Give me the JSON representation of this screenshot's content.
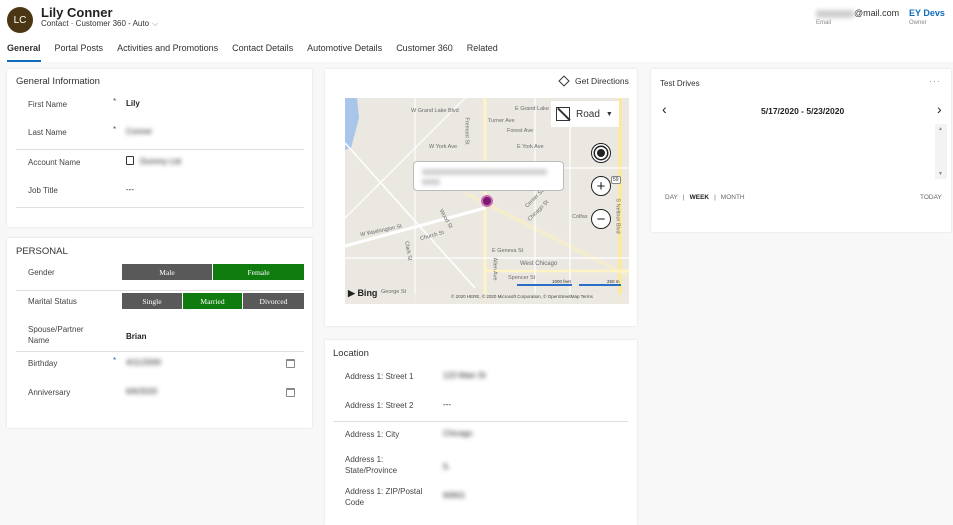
{
  "header": {
    "avatar_initials": "LC",
    "record_name": "Lily Conner",
    "record_subtitle": "Contact · Customer 360 - Auto",
    "email_suffix": "@mail.com",
    "email_label": "Email",
    "owner_value": "EY Devs",
    "owner_label": "Owner",
    "owner_color": "#0f6cbd"
  },
  "tabs": [
    {
      "label": "General",
      "active": true
    },
    {
      "label": "Portal Posts"
    },
    {
      "label": "Activities and Promotions"
    },
    {
      "label": "Contact Details"
    },
    {
      "label": "Automotive Details"
    },
    {
      "label": "Customer 360"
    },
    {
      "label": "Related"
    }
  ],
  "general_info": {
    "title": "General Information",
    "fields": [
      {
        "label": "First Name",
        "required": "*",
        "value": "Lily"
      },
      {
        "label": "Last Name",
        "required": "*",
        "value": "Conner",
        "blurred": true
      },
      {
        "label": "Account Name",
        "value": "Dummy Ltd",
        "blurred": true,
        "icon": "account-icon"
      },
      {
        "label": "Job Title",
        "value": "---"
      }
    ]
  },
  "personal": {
    "title": "PERSONAL",
    "gender": {
      "label": "Gender",
      "options": [
        "Male",
        "Female"
      ],
      "selected": "Female"
    },
    "marital_status": {
      "label": "Marital Status",
      "options": [
        "Single",
        "Married",
        "Divorced"
      ],
      "selected": "Married"
    },
    "spouse": {
      "label": "Spouse/Partner Name",
      "value": "Brian"
    },
    "birthday": {
      "label": "Birthday",
      "required": "*",
      "value": "4/11/2000",
      "blurred": true
    },
    "anniversary": {
      "label": "Anniversary",
      "value": "6/6/2020",
      "blurred": true
    },
    "selected_color": "#107c10",
    "unselected_color": "#595959"
  },
  "map": {
    "get_directions_label": "Get Directions",
    "map_type": "Road",
    "streets": [
      "W Grand Lake Blvd",
      "E Grand Lake",
      "Turner Ave",
      "Fremont St",
      "Forest Ave",
      "W York Ave",
      "E York Ave",
      "W Washington St",
      "Church St",
      "Wood St",
      "E Geneva St",
      "Chicago St",
      "Center St",
      "West Chicago",
      "Spencer St",
      "Allen Ave",
      "George St",
      "Clark St",
      "S Neltnor Blvd",
      "Colfax"
    ],
    "route_badge": "59",
    "logo": "Bing",
    "scale_feet": "1000 feet",
    "scale_m": "250 m",
    "copyright": "© 2020 HERE, © 2020 Microsoft Corporation, © OpenStreetMap Terms"
  },
  "location": {
    "title": "Location",
    "fields": [
      {
        "label": "Address 1: Street 1",
        "value": "123 Main St",
        "blurred": true
      },
      {
        "label": "Address 1: Street 2",
        "value": "---"
      },
      {
        "label": "Address 1: City",
        "value": "Chicago",
        "blurred": true
      },
      {
        "label": "Address 1: State/Province",
        "value": "IL",
        "blurred": true
      },
      {
        "label": "Address 1: ZIP/Postal Code",
        "value": "60601",
        "blurred": true
      }
    ]
  },
  "test_drives": {
    "title": "Test Drives",
    "more_label": "···",
    "date_range": "5/17/2020 - 5/23/2020",
    "views": [
      "DAY",
      "WEEK",
      "MONTH"
    ],
    "selected_view": "WEEK",
    "today_label": "TODAY"
  }
}
